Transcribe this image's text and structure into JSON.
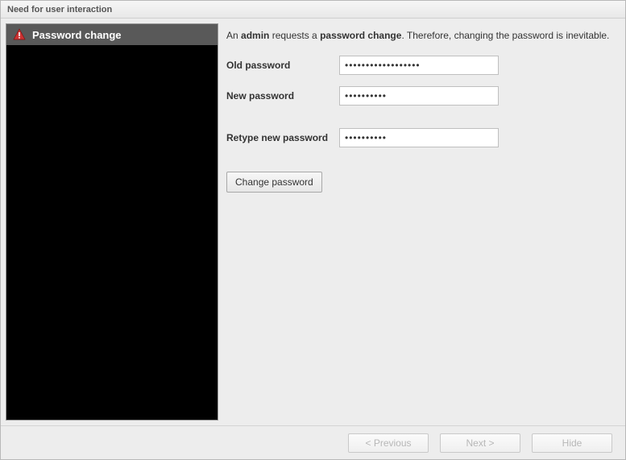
{
  "window": {
    "title": "Need for user interaction"
  },
  "sidebar": {
    "items": [
      {
        "icon": "warning-icon",
        "label": "Password change"
      }
    ]
  },
  "main": {
    "notice_parts": {
      "t1": "An ",
      "b1": "admin",
      "t2": " requests a ",
      "b2": "password change",
      "t3": ". Therefore, changing the password is inevitable."
    },
    "fields": {
      "old_password": {
        "label": "Old password",
        "value": "••••••••••••••••••"
      },
      "new_password": {
        "label": "New password",
        "value": "••••••••••"
      },
      "retype_password": {
        "label": "Retype new password",
        "value": "••••••••••"
      }
    },
    "change_button": "Change password"
  },
  "footer": {
    "previous": "< Previous",
    "next": "Next >",
    "hide": "Hide"
  }
}
